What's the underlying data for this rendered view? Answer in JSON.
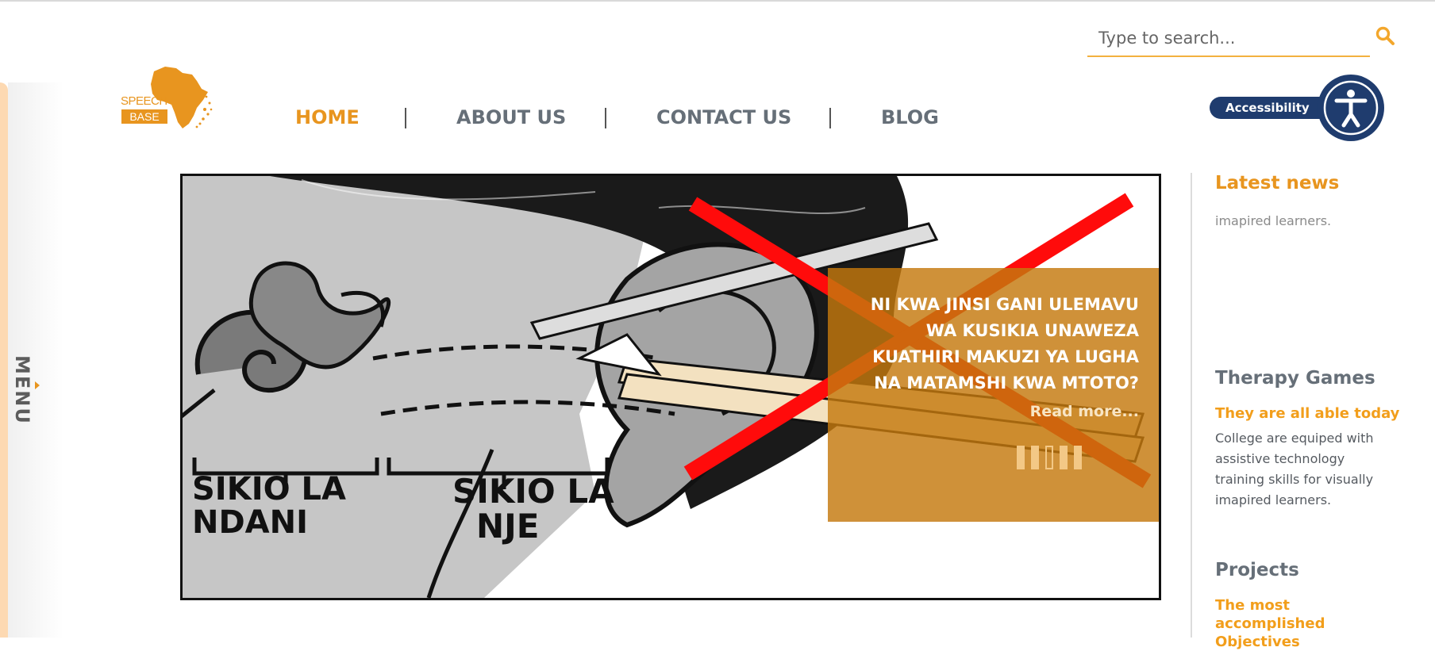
{
  "search": {
    "placeholder": "Type to search...",
    "icon": "search-icon",
    "icon_color": "#f3a72c"
  },
  "logo": {
    "line1": "SPEECH",
    "line2": "BASE",
    "color": "#e8951f"
  },
  "nav": {
    "items": [
      {
        "label": "HOME",
        "active": true
      },
      {
        "label": "ABOUT US",
        "active": false
      },
      {
        "label": "CONTACT US",
        "active": false
      },
      {
        "label": "BLOG",
        "active": false
      }
    ],
    "active_color": "#e8951f",
    "color": "#666f78"
  },
  "accessibility": {
    "label": "Accessibility",
    "icon": "accessibility-icon",
    "color": "#1f3c6e"
  },
  "side_menu": {
    "label": "MENU"
  },
  "slider": {
    "image_labels": {
      "inner": [
        "SIKIO LA",
        "NDANI"
      ],
      "outer": [
        "SIKIO LA",
        "NJE"
      ]
    },
    "headline": "NI KWA JINSI GANI ULEMAVU WA KUSIKIA UNAWEZA KUATHIRI MAKUZI YA LUGHA NA MATAMSHI KWA MTOTO?",
    "read_more": "Read more...",
    "pager": {
      "total": 5,
      "active": 3
    },
    "caption_color": "#c4790e"
  },
  "sidebar": {
    "latest_news": {
      "title": "Latest news",
      "partial_text": "imapired learners."
    },
    "therapy_games": {
      "title": "Therapy Games",
      "subtitle": "They are all able today",
      "body": "College are equiped with assistive technology training skills for visually imapired learners."
    },
    "projects": {
      "title": "Projects",
      "subtitle": "The most accomplished Objectives"
    }
  }
}
